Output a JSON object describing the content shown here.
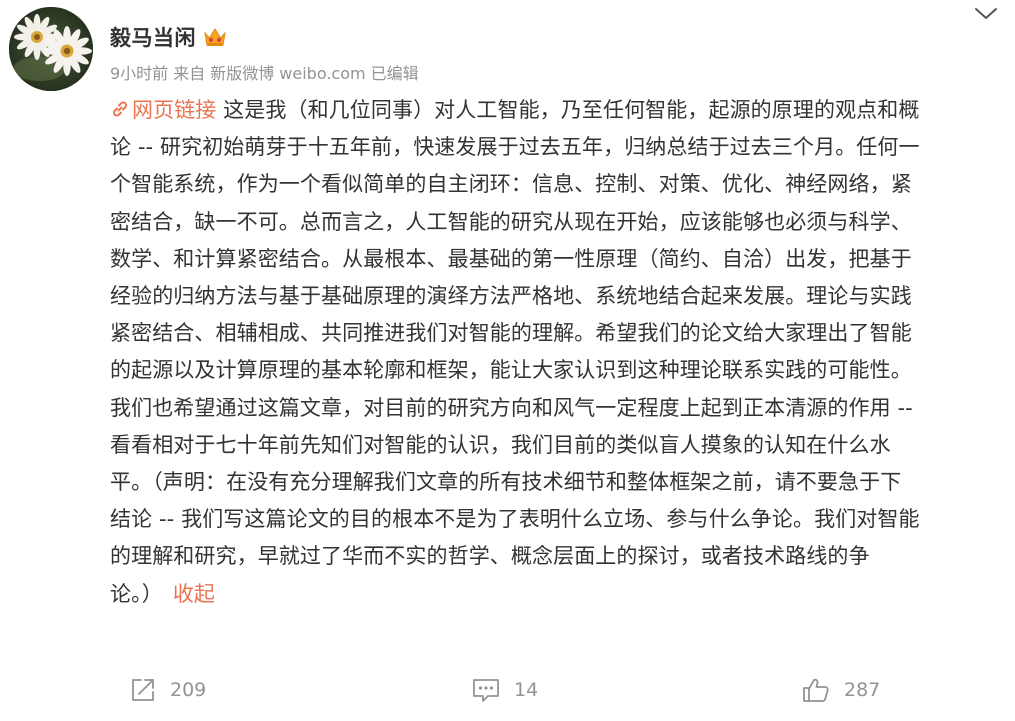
{
  "user": {
    "name": "毅马当闲",
    "badge": "crown-vip-icon"
  },
  "meta": {
    "time": "9小时前",
    "from_label": "来自",
    "source": "新版微博 weibo.com",
    "edited": "已编辑"
  },
  "post": {
    "link_icon": "link-icon",
    "link_label": "网页链接",
    "text_lines": [
      "这是我（和几位同事）对人工智能，乃至任何智能，起源的原理的观点和概",
      "论 -- 研究初始萌芽于十五年前，快速发展于过去五年，归纳总结于过去三个月。任何一",
      "个智能系统，作为一个看似简单的自主闭环：信息、控制、对策、优化、神经网络，紧",
      "密结合，缺一不可。总而言之，人工智能的研究从现在开始，应该能够也必须与科学、",
      "数学、和计算紧密结合。从最根本、最基础的第一性原理（简约、自洽）出发，把基于",
      "经验的归纳方法与基于基础原理的演绎方法严格地、系统地结合起来发展。理论与实践",
      "紧密结合、相辅相成、共同推进我们对智能的理解。希望我们的论文给大家理出了智能",
      "的起源以及计算原理的基本轮廓和框架，能让大家认识到这种理论联系实践的可能性。",
      "我们也希望通过这篇文章，对目前的研究方向和风气一定程度上起到正本清源的作用 --",
      "看看相对于七十年前先知们对智能的认识，我们目前的类似盲人摸象的认知在什么水",
      "平。（声明：在没有充分理解我们文章的所有技术细节和整体框架之前，请不要急于下",
      "结论 -- 我们写这篇论文的目的根本不是为了表明什么立场、参与什么争论。我们对智能",
      "的理解和研究，早就过了华而不实的哲学、概念层面上的探讨，或者技术路线的争",
      "论。）"
    ],
    "collapse_label": "收起"
  },
  "actions": {
    "repost": {
      "icon": "repost-icon",
      "count": "209"
    },
    "comment": {
      "icon": "comment-icon",
      "count": "14"
    },
    "like": {
      "icon": "thumbs-up-icon",
      "count": "287"
    }
  },
  "colors": {
    "accent": "#eb7350",
    "text": "#333333",
    "muted": "#939393"
  }
}
